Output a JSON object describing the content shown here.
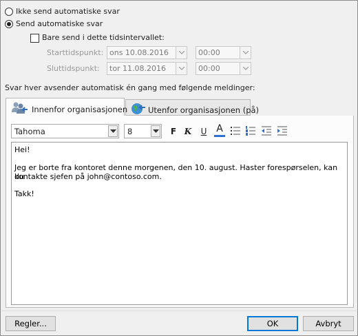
{
  "reply_mode": {
    "option_off": "Ikke send automatiske svar",
    "option_on": "Send automatiske svar",
    "selected": "on"
  },
  "time_range": {
    "checkbox_label": "Bare send i dette tidsintervallet:",
    "checked": false,
    "start_label": "Starttidspunkt:",
    "start_date": "ons 10.08.2016",
    "start_time": "00:00",
    "end_label": "Sluttidspunkt:",
    "end_date": "tor 11.08.2016",
    "end_time": "00:00"
  },
  "instruction": "Svar hver avsender automatisk én gang med følgende meldinger:",
  "tabs": [
    {
      "label": "Innenfor organisasjonen",
      "icon": "people-icon",
      "active": true
    },
    {
      "label": "Utenfor organisasjonen (på)",
      "icon": "globe-icon",
      "active": false
    }
  ],
  "toolbar": {
    "font_name": "Tahoma",
    "font_size": "8",
    "bold": "F",
    "italic": "K",
    "underline": "U",
    "font_color": "A",
    "font_color_value": "#2f6fd0"
  },
  "message": {
    "line1": "Hei!",
    "line2": "Jeg er borte fra kontoret denne morgenen, den 10. august. Haster forespørselen, kan du",
    "line3": "kontakte sjefen på john@contoso.com.",
    "line4": "Takk!"
  },
  "buttons": {
    "rules": "Regler...",
    "ok": "OK",
    "cancel": "Avbryt"
  }
}
